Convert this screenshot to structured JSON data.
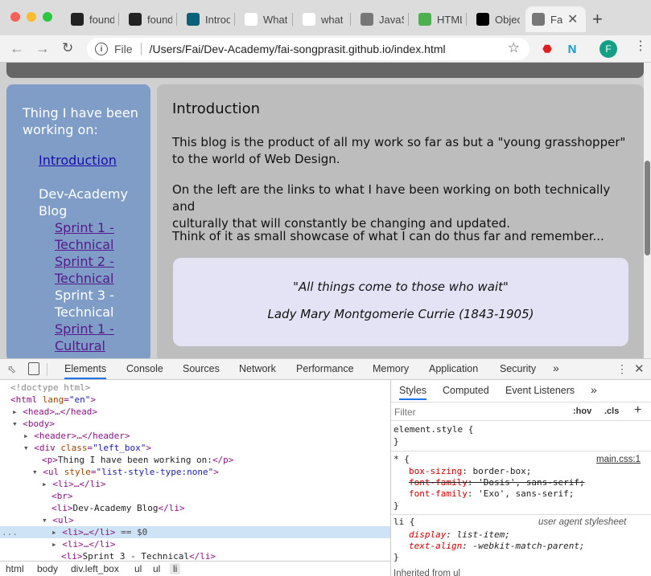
{
  "tabs": [
    {
      "label": "found",
      "icon": "github-icon",
      "color": "#222"
    },
    {
      "label": "found",
      "icon": "github-icon",
      "color": "#222"
    },
    {
      "label": "Introd",
      "icon": "codepen-icon",
      "color": "#0a5f7a"
    },
    {
      "label": "What",
      "icon": "w3schools-icon",
      "color": "#fff"
    },
    {
      "label": "what",
      "icon": "google-icon",
      "color": "#fff"
    },
    {
      "label": "JavaS",
      "icon": "globe-icon",
      "color": "#777"
    },
    {
      "label": "HTML",
      "icon": "w3-icon",
      "color": "#4caf50"
    },
    {
      "label": "Objec",
      "icon": "dev-icon",
      "color": "#000"
    },
    {
      "label": "Fa",
      "icon": "globe-icon",
      "color": "#777"
    }
  ],
  "address": {
    "scheme_label": "File",
    "url": "/Users/Fai/Dev-Academy/fai-songprasit.github.io/index.html"
  },
  "profile_initial": "F",
  "page": {
    "sidebar": {
      "heading": "Thing I have been working on:",
      "intro_link": "Introduction",
      "blog_label": [
        "Dev-Academy",
        "Blog"
      ],
      "items": [
        {
          "lines": [
            "Sprint 1 -",
            "Technical"
          ],
          "type": "visited"
        },
        {
          "lines": [
            "Sprint 2 -",
            "Technical"
          ],
          "type": "visited"
        },
        {
          "lines": [
            "Sprint 3 -",
            "Technical"
          ],
          "type": "plain"
        },
        {
          "lines": [
            "Sprint 1 -",
            "Cultural"
          ],
          "type": "visited"
        }
      ]
    },
    "content": {
      "title": "Introduction",
      "p1": [
        "This blog is the product of all my work so far as but a \"young grasshopper\"",
        "to the world of Web Design."
      ],
      "p2": [
        "On the left are the links to what I have been working on both technically and",
        "culturally that will constantly be changing and updated."
      ],
      "p3": "Think of it as small showcase of what I can do thus far and remember...",
      "quote": "\"All things come to those who wait\"",
      "author": "Lady Mary Montgomerie Currie (1843-1905)"
    }
  },
  "devtools": {
    "tabs": [
      "Elements",
      "Console",
      "Sources",
      "Network",
      "Performance",
      "Memory",
      "Application",
      "Security"
    ],
    "more": "»",
    "dom": {
      "doctype": "<!doctype html>",
      "html_open": "<html lang=\"en\">",
      "head": "<head>…</head>",
      "body": "<body>",
      "header": "<header>…</header>",
      "div_tag": "div",
      "div_attr": "class",
      "div_val": "\"left_box\"",
      "p_line": "Thing I have been working on:",
      "ul_attr": "style",
      "ul_val": "\"list-style-type:none\"",
      "li_collapsed": "<li>…</li>",
      "br": "<br>",
      "li_blog": "Dev-Academy Blog",
      "ul2": "<ul>",
      "selected_suffix": " == $0",
      "li_sprint3": "Sprint 3 - Technical"
    },
    "breadcrumbs": [
      "html",
      "body",
      "div.left_box",
      "ul",
      "ul",
      "li"
    ],
    "styles": {
      "tabs": [
        "Styles",
        "Computed",
        "Event Listeners"
      ],
      "filter_placeholder": "Filter",
      "hov": ":hov",
      "cls": ".cls",
      "element_style": "element.style {",
      "rule1_selector": "* {",
      "rule1_source": "main.css:1",
      "rule1_props": [
        {
          "name": "box-sizing",
          "value": "border-box;",
          "struck": false
        },
        {
          "name": "font-family",
          "value": "'Dosis', sans-serif;",
          "struck": true
        },
        {
          "name": "font-family",
          "value": "'Exo', sans-serif;",
          "struck": false
        }
      ],
      "rule2_selector": "li {",
      "rule2_source": "user agent stylesheet",
      "rule2_props": [
        {
          "name": "display",
          "value": "list-item;"
        },
        {
          "name": "text-align",
          "value": "-webkit-match-parent;"
        }
      ],
      "inherited": "Inherited from ul"
    }
  }
}
